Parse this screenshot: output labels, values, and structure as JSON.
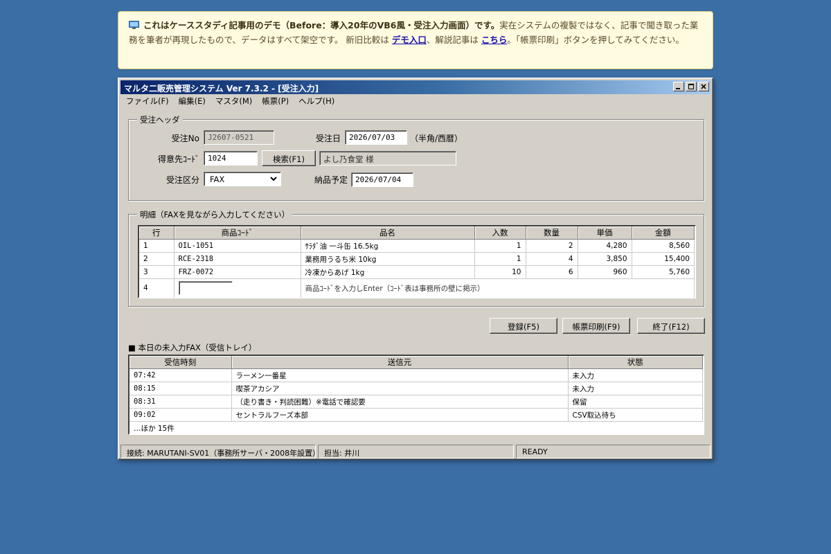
{
  "notice": {
    "icon": "monitor-icon",
    "bold_lead": "これはケーススタディ記事用のデモ（Before：導入20年のVB6風・受注入力画面）です。",
    "text1": "実在システムの複製ではなく、記事で聞き取った業務を筆者が再現したもので、データはすべて架空です。 新旧比較は ",
    "link_demo": "デモ入口",
    "text2": "、解説記事は ",
    "link_article": "こちら",
    "text3": "。「帳票印刷」ボタンを押してみてください。"
  },
  "window": {
    "title": "マルタ二販売管理システム Ver 7.3.2 - [受注入力]",
    "controls": [
      "minimize-icon",
      "maximize-icon",
      "close-icon"
    ]
  },
  "menu": [
    "ファイル(F)",
    "編集(E)",
    "マスタ(M)",
    "帳票(P)",
    "ヘルプ(H)"
  ],
  "header": {
    "legend": "受注ヘッダ",
    "order_no_label": "受注No",
    "order_no": "J2607-0521",
    "order_date_label": "受注日",
    "order_date": "2026/07/03",
    "order_date_hint": "（半角/西暦）",
    "customer_code_label": "得意先ｺｰﾄﾞ",
    "customer_code": "1024",
    "search_button": "検索(F1)",
    "customer_name": "よし乃食堂 様",
    "order_type_label": "受注区分",
    "order_type": "FAX",
    "delivery_label": "納品予定",
    "delivery_date": "2026/07/04"
  },
  "details": {
    "legend": "明細（FAXを見ながら入力してください）",
    "columns": [
      "行",
      "商品ｺｰﾄﾞ",
      "品名",
      "入数",
      "数量",
      "単価",
      "金額"
    ],
    "rows": [
      {
        "no": "1",
        "code": "OIL-1051",
        "name": "ｻﾗﾀﾞ油 一斗缶 16.5kg",
        "pack": "1",
        "qty": "2",
        "price": "4,280",
        "amount": "8,560"
      },
      {
        "no": "2",
        "code": "RCE-2318",
        "name": "業務用うるち米 10kg",
        "pack": "1",
        "qty": "4",
        "price": "3,850",
        "amount": "15,400"
      },
      {
        "no": "3",
        "code": "FRZ-0072",
        "name": "冷凍からあげ 1kg",
        "pack": "10",
        "qty": "6",
        "price": "960",
        "amount": "5,760"
      }
    ],
    "input_row_no": "4",
    "input_hint": "商品ｺｰﾄﾞを入力しEnter（ｺｰﾄﾞ表は事務所の壁に掲示）"
  },
  "actions": {
    "register": "登録(F5)",
    "print": "帳票印刷(F9)",
    "exit": "終了(F12)"
  },
  "fax_tray": {
    "title": "■ 本日の未入力FAX（受信トレイ）",
    "columns": [
      "受信時刻",
      "送信元",
      "状態"
    ],
    "rows": [
      {
        "time": "07:42",
        "sender": "ラーメン一番星",
        "status": "未入力"
      },
      {
        "time": "08:15",
        "sender": "喫茶アカシア",
        "status": "未入力"
      },
      {
        "time": "08:31",
        "sender": "（走り書き・判読困難）※電話で確認要",
        "status": "保留"
      },
      {
        "time": "09:02",
        "sender": "セントラルフーズ本部",
        "status": "CSV取込待ち"
      }
    ],
    "more": "…ほか 15件"
  },
  "status": {
    "connection": "接続: MARUTANI-SV01（事務所サーバ・2008年設置）",
    "user": "担当: 井川",
    "state": "READY"
  }
}
